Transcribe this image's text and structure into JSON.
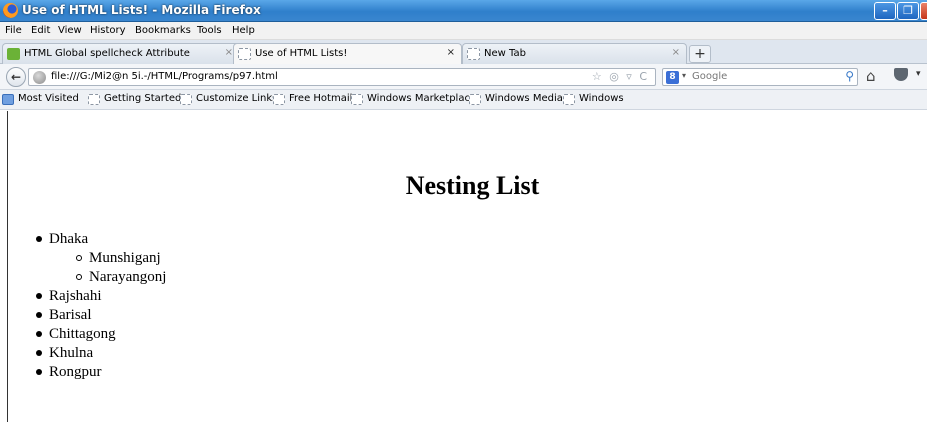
{
  "window": {
    "title": "Use of HTML Lists! - Mozilla Firefox",
    "controls": {
      "minimize": "–",
      "maximize": "❐",
      "close": "X"
    }
  },
  "menu": [
    "File",
    "Edit",
    "View",
    "History",
    "Bookmarks",
    "Tools",
    "Help"
  ],
  "tabs": [
    {
      "label": "HTML Global spellcheck Attribute",
      "close": "×",
      "icon": "w3-icon"
    },
    {
      "label": "Use of HTML Lists!",
      "close": "×",
      "icon": "blank-page-icon",
      "active": true
    },
    {
      "label": "New Tab",
      "close": "×",
      "icon": "blank-page-icon"
    }
  ],
  "new_tab": "+",
  "nav": {
    "back": "←",
    "url": "file:///G:/Mi2@n 5i.-/HTML/Programs/p97.html",
    "url_icons": "☆ ◎ ▿ C",
    "search_engine_icon": "8",
    "search_placeholder": "Google",
    "search_go": "⚲",
    "home": "⌂",
    "more": "▾"
  },
  "bookmarks": [
    "Most Visited",
    "Getting Started",
    "Customize Links",
    "Free Hotmail",
    "Windows Marketplace",
    "Windows Media",
    "Windows"
  ],
  "page": {
    "heading": "Nesting List",
    "list": [
      {
        "text": "Dhaka",
        "children": [
          "Munshiganj",
          "Narayangonj"
        ]
      },
      {
        "text": "Rajshahi"
      },
      {
        "text": "Barisal"
      },
      {
        "text": "Chittagong"
      },
      {
        "text": "Khulna"
      },
      {
        "text": "Rongpur"
      }
    ]
  }
}
